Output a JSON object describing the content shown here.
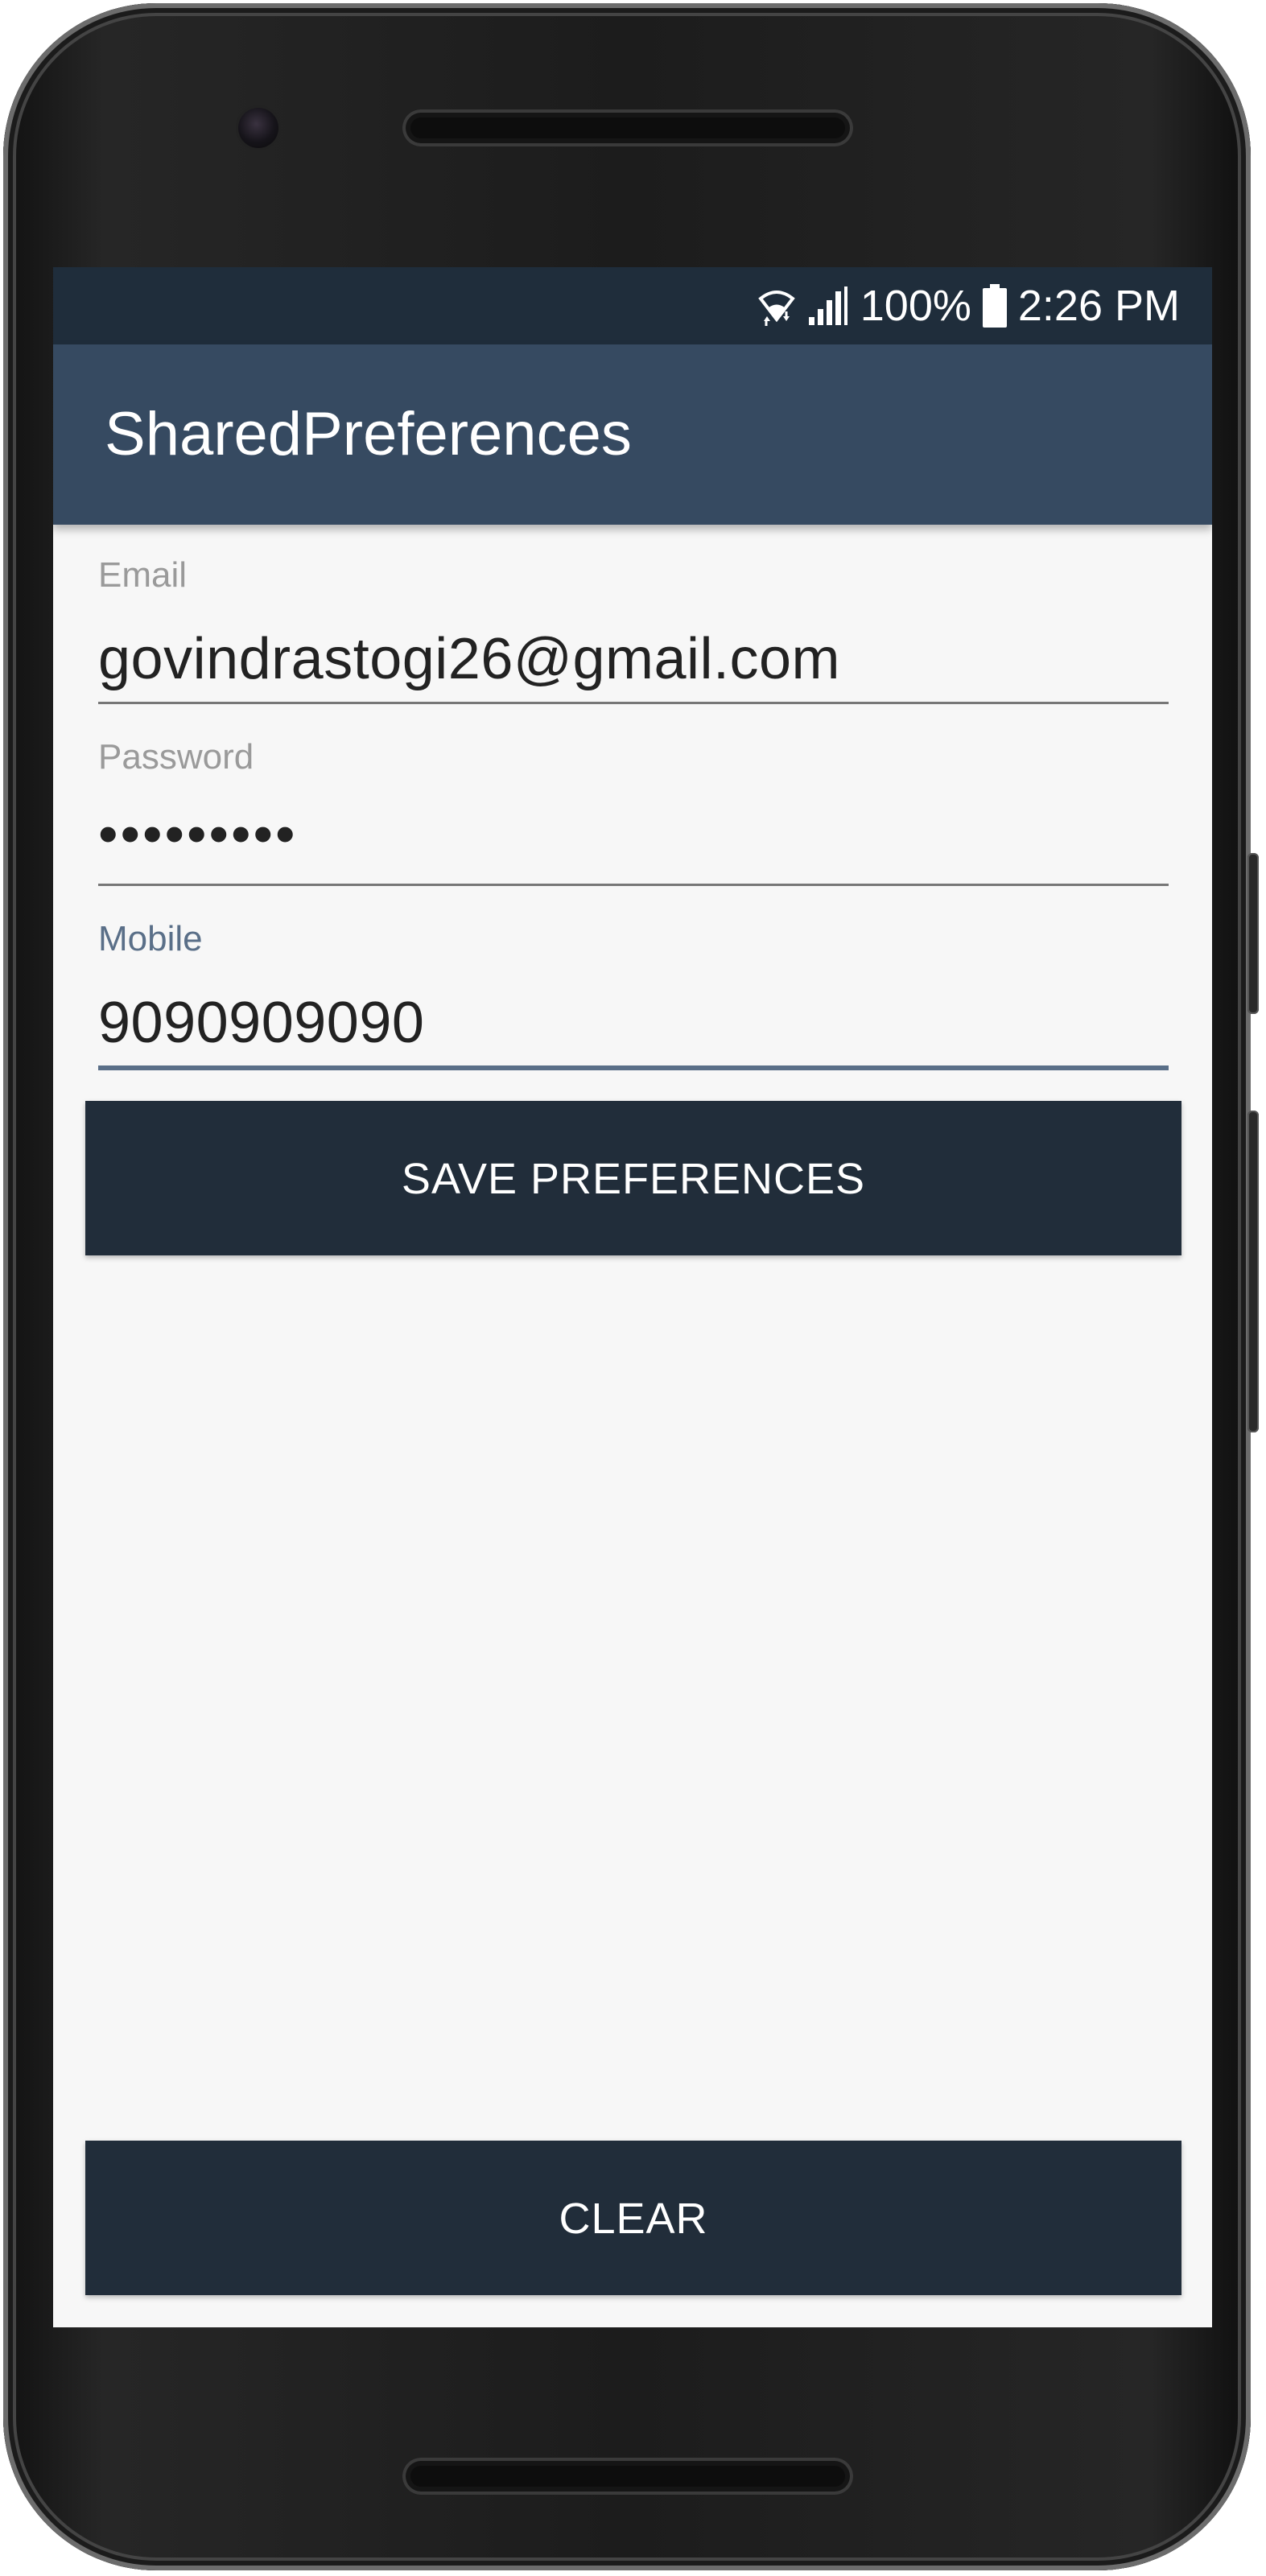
{
  "status_bar": {
    "battery_level": "100%",
    "time": "2:26 PM",
    "icons": [
      "wifi-icon",
      "cellular-signal-icon",
      "battery-icon"
    ]
  },
  "app_bar": {
    "title": "SharedPreferences"
  },
  "form": {
    "email": {
      "label": "Email",
      "value": "govindrastogi26@gmail.com"
    },
    "password": {
      "label": "Password",
      "value": "•••••••••"
    },
    "mobile": {
      "label": "Mobile",
      "value": "9090909090"
    }
  },
  "buttons": {
    "save_label": "SAVE PREFERENCES",
    "clear_label": "CLEAR"
  },
  "colors": {
    "status_bar": "#1f2d3b",
    "app_bar": "#364a61",
    "button": "#212d3a",
    "focus_accent": "#5a6f88",
    "screen_background": "#f7f7f7"
  }
}
